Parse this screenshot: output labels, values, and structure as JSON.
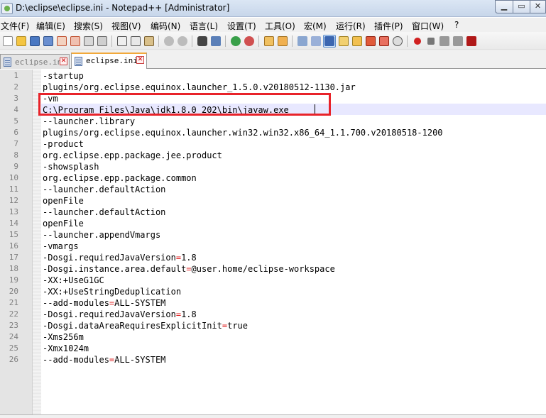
{
  "window": {
    "title": "D:\\eclipse\\eclipse.ini - Notepad++ [Administrator]",
    "min_glyph": "▁",
    "max_glyph": "▭",
    "close_glyph": "✕"
  },
  "menu": [
    "文件(F)",
    "编辑(E)",
    "搜索(S)",
    "视图(V)",
    "编码(N)",
    "语言(L)",
    "设置(T)",
    "工具(O)",
    "宏(M)",
    "运行(R)",
    "插件(P)",
    "窗口(W)",
    "?"
  ],
  "tabs": [
    {
      "label": "eclipse.ini",
      "close": "✕",
      "active": false
    },
    {
      "label": "eclipse.ini",
      "close": "✕",
      "active": true
    }
  ],
  "toolbar_icons": [
    "new-file-icon",
    "open-file-icon",
    "save-icon",
    "save-all-icon",
    "close-icon",
    "close-all-icon",
    "print-icon",
    "cut-icon",
    "copy-icon",
    "paste-icon",
    "undo-icon",
    "redo-icon",
    "find-icon",
    "replace-icon",
    "zoom-in-icon",
    "zoom-out-icon",
    "sync-vertical-icon",
    "sync-horizontal-icon",
    "word-wrap-icon",
    "show-all-chars-icon",
    "indent-guide-icon",
    "language-icon",
    "doc-map-icon",
    "function-list-icon",
    "folder-workspace-icon",
    "monitor-icon",
    "record-macro-icon",
    "stop-macro-icon",
    "play-macro-icon",
    "play-multiple-icon",
    "save-macro-icon"
  ],
  "lines": [
    "-startup",
    "plugins/org.eclipse.equinox.launcher_1.5.0.v20180512-1130.jar",
    "-vm",
    "C:\\Program Files\\Java\\jdk1.8.0_202\\bin\\javaw.exe",
    "--launcher.library",
    "plugins/org.eclipse.equinox.launcher.win32.win32.x86_64_1.1.700.v20180518-1200",
    "-product",
    "org.eclipse.epp.package.jee.product",
    "-showsplash",
    "org.eclipse.epp.package.common",
    "--launcher.defaultAction",
    "openFile",
    "--launcher.defaultAction",
    "openFile",
    "--launcher.appendVmargs",
    "-vmargs",
    "-Dosgi.requiredJavaVersion=1.8",
    "-Dosgi.instance.area.default=@user.home/eclipse-workspace",
    "-XX:+UseG1GC",
    "-XX:+UseStringDeduplication",
    "--add-modules=ALL-SYSTEM",
    "-Dosgi.requiredJavaVersion=1.8",
    "-Dosgi.dataAreaRequiresExplicitInit=true",
    "-Xms256m",
    "-Xmx1024m",
    "--add-modules=ALL-SYSTEM"
  ],
  "line_numbers": [
    "1",
    "2",
    "3",
    "4",
    "5",
    "6",
    "7",
    "8",
    "9",
    "10",
    "11",
    "12",
    "13",
    "14",
    "15",
    "16",
    "17",
    "18",
    "19",
    "20",
    "21",
    "22",
    "23",
    "24",
    "25",
    "26"
  ],
  "colors": {
    "highlight_box": "#e8232a",
    "equals_sign": "#e02020",
    "current_line": "#e8e8ff",
    "active_tab_accent": "#f2a93b"
  }
}
